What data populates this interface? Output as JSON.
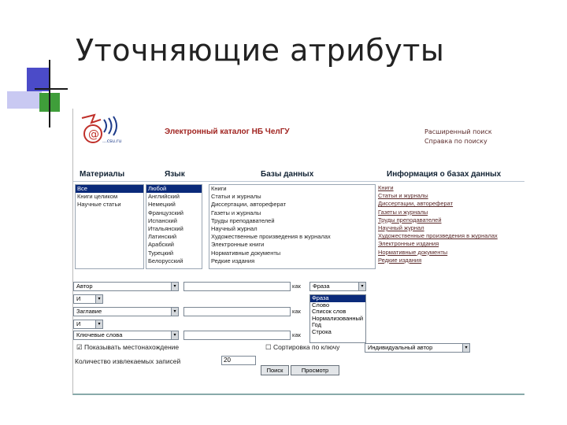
{
  "slide": {
    "title": "Уточняющие атрибуты"
  },
  "catalog": {
    "title": "Электронный каталог НБ ЧелГУ",
    "logo_text": "@",
    "logo_sub": "...csu.ru",
    "links": [
      "Расширенный поиск",
      "Справка по поиску"
    ]
  },
  "filters": {
    "headers": {
      "materials": "Материалы",
      "language": "Язык",
      "databases": "Базы данных",
      "db_info": "Информация о базах данных"
    },
    "materials": [
      "Все",
      "Книги целиком",
      "Научные статьи"
    ],
    "materials_selected": 0,
    "languages": [
      "Любой",
      "Английский",
      "Немецкий",
      "Французский",
      "Испанский",
      "Итальянский",
      "Латинский",
      "Арабский",
      "Турецкий",
      "Белорусский"
    ],
    "languages_selected": 0,
    "databases": [
      "Книги",
      "Статьи и журналы",
      "Диссертации, автореферат",
      "Газеты и журналы",
      "Труды преподавателей",
      "Научный журнал",
      "Художественные произведения в журналах",
      "Электронные книги",
      "Нормативные документы",
      "Редкие издания"
    ],
    "db_info_links": [
      "Книги",
      "Статьи и журналы",
      "Диссертации, автореферат",
      "Газеты и журналы",
      "Труды преподавателей",
      "Научный журнал",
      "Художественные произведения в журналах",
      "Электронные издания",
      "Нормативные документы",
      "Редкие издания"
    ]
  },
  "search": {
    "rows": [
      {
        "field": "Автор",
        "op": "Фраза"
      },
      {
        "field": "Заглавие",
        "op": ""
      },
      {
        "field": "Ключевые слова",
        "op": ""
      }
    ],
    "connectors": [
      "И",
      "И"
    ],
    "kak_label": "как",
    "match_options": [
      "Фраза",
      "Слово",
      "Список слов",
      "Нормализованный",
      "Год",
      "Строка"
    ],
    "match_selected": 0,
    "show_location": "Показывать местонахождение",
    "show_location_checked": true,
    "sort_label": "Сортировка по ключу",
    "sort_checked": false,
    "sort_value": "Индивидуальный автор",
    "records_label": "Количество извлекаемых записей",
    "records_value": "20",
    "search_button": "Поиск",
    "view_button": "Просмотр"
  },
  "colors": {
    "title_red": "#a0231f",
    "selection": "#0a2a7a"
  }
}
